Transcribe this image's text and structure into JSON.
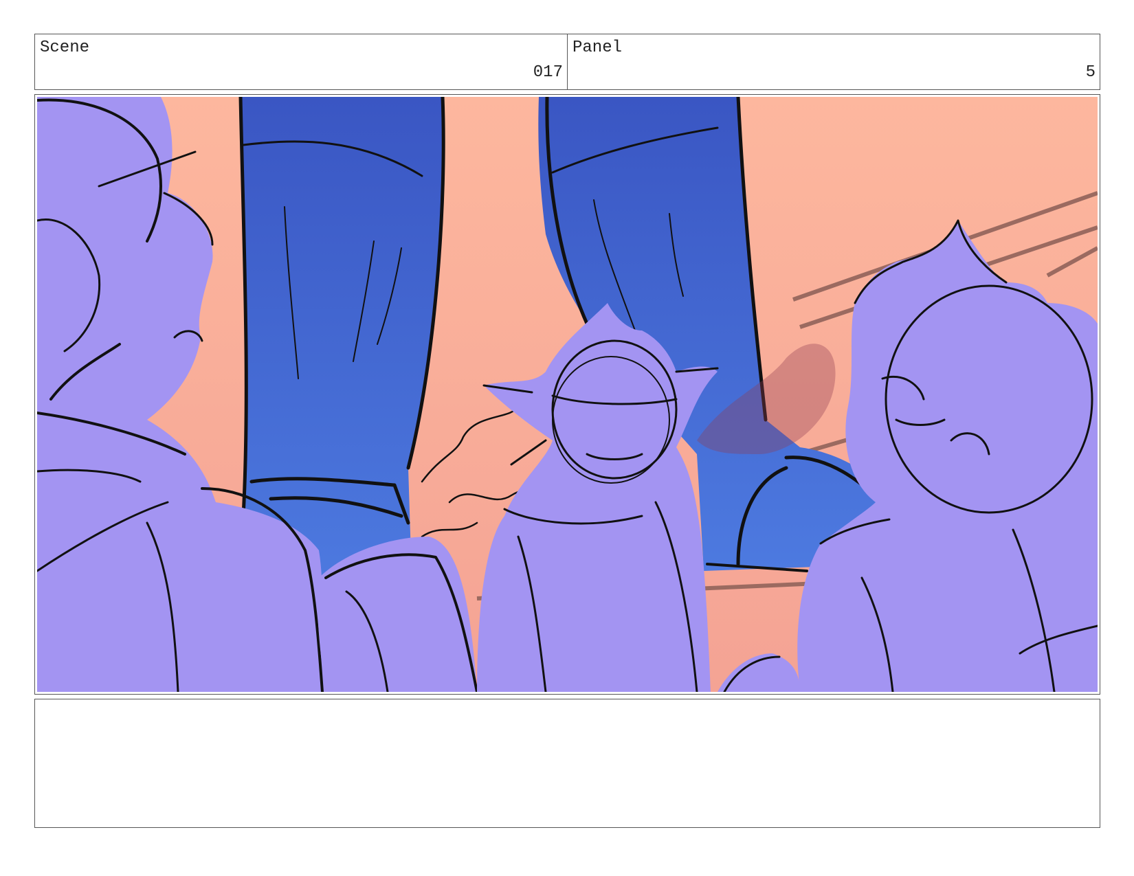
{
  "header": {
    "scene_label": "Scene",
    "scene_number": "017",
    "panel_label": "Panel",
    "panel_number": "5"
  },
  "notes": {
    "text": ""
  },
  "colors": {
    "sky_top": "#fdb79e",
    "sky_bottom": "#f4a394",
    "figure_fill": "#a394f2",
    "leg_top": "#3a56c3",
    "leg_bottom": "#4d7ae0",
    "line": "#111111"
  }
}
